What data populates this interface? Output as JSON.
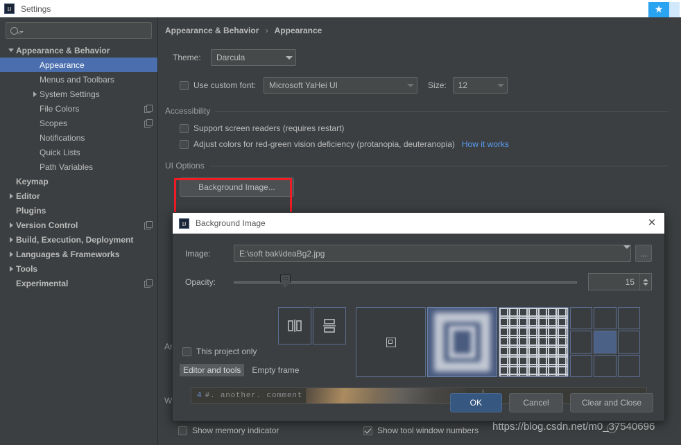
{
  "window": {
    "title": "Settings",
    "logo_icon": "intellij-idea-icon",
    "badge_icon": "baidu-netdisk-icon"
  },
  "sidebar": {
    "search": {
      "placeholder": "",
      "value": "",
      "icon": "search-icon"
    },
    "items": [
      {
        "label": "Appearance & Behavior",
        "indent": 0,
        "twisty": "down",
        "bold": true,
        "selected": false,
        "cfg": false
      },
      {
        "label": "Appearance",
        "indent": 1,
        "twisty": "none",
        "bold": false,
        "selected": true,
        "cfg": false
      },
      {
        "label": "Menus and Toolbars",
        "indent": 1,
        "twisty": "none",
        "bold": false,
        "selected": false,
        "cfg": false
      },
      {
        "label": "System Settings",
        "indent": 1,
        "twisty": "right",
        "bold": false,
        "selected": false,
        "cfg": false
      },
      {
        "label": "File Colors",
        "indent": 1,
        "twisty": "none",
        "bold": false,
        "selected": false,
        "cfg": true
      },
      {
        "label": "Scopes",
        "indent": 1,
        "twisty": "none",
        "bold": false,
        "selected": false,
        "cfg": true
      },
      {
        "label": "Notifications",
        "indent": 1,
        "twisty": "none",
        "bold": false,
        "selected": false,
        "cfg": false
      },
      {
        "label": "Quick Lists",
        "indent": 1,
        "twisty": "none",
        "bold": false,
        "selected": false,
        "cfg": false
      },
      {
        "label": "Path Variables",
        "indent": 1,
        "twisty": "none",
        "bold": false,
        "selected": false,
        "cfg": false
      },
      {
        "label": "Keymap",
        "indent": 0,
        "twisty": "none",
        "bold": true,
        "selected": false,
        "cfg": false
      },
      {
        "label": "Editor",
        "indent": 0,
        "twisty": "right",
        "bold": true,
        "selected": false,
        "cfg": false
      },
      {
        "label": "Plugins",
        "indent": 0,
        "twisty": "none",
        "bold": true,
        "selected": false,
        "cfg": false
      },
      {
        "label": "Version Control",
        "indent": 0,
        "twisty": "right",
        "bold": true,
        "selected": false,
        "cfg": true
      },
      {
        "label": "Build, Execution, Deployment",
        "indent": 0,
        "twisty": "right",
        "bold": true,
        "selected": false,
        "cfg": false
      },
      {
        "label": "Languages & Frameworks",
        "indent": 0,
        "twisty": "right",
        "bold": true,
        "selected": false,
        "cfg": false
      },
      {
        "label": "Tools",
        "indent": 0,
        "twisty": "right",
        "bold": true,
        "selected": false,
        "cfg": false
      },
      {
        "label": "Experimental",
        "indent": 0,
        "twisty": "none",
        "bold": true,
        "selected": false,
        "cfg": true
      }
    ]
  },
  "main": {
    "breadcrumb": {
      "root": "Appearance & Behavior",
      "separator": "›",
      "leaf": "Appearance"
    },
    "theme": {
      "label": "Theme:",
      "value": "Darcula"
    },
    "custom_font": {
      "checkbox_label": "Use custom font:",
      "checked": false,
      "font_value": "Microsoft YaHei UI",
      "size_label": "Size:",
      "size_value": "12"
    },
    "accessibility": {
      "group_label": "Accessibility",
      "screen_readers": {
        "label": "Support screen readers (requires restart)",
        "checked": false
      },
      "color_deficiency": {
        "label": "Adjust colors for red-green vision deficiency (protanopia, deuteranopia)",
        "checked": false,
        "link": "How it works"
      }
    },
    "ui_options": {
      "group_label": "UI Options",
      "background_image_button": "Background Image...",
      "highlight_color": "#ee1c25"
    },
    "obscured_labels": {
      "antialiasing": "An",
      "window": "W"
    },
    "bottom_options": [
      {
        "label": "Show memory indicator",
        "checked": false
      },
      {
        "label": "Show tool window numbers",
        "checked": true
      }
    ]
  },
  "dialog": {
    "title": "Background Image",
    "logo_icon": "intellij-idea-icon",
    "close_icon": "close-icon",
    "image": {
      "label": "Image:",
      "value": "E:\\soft bak\\ideaBg2.jpg",
      "browse_button": "..."
    },
    "opacity": {
      "label": "Opacity:",
      "value": "15",
      "percent": 15
    },
    "flip_buttons": [
      {
        "name": "flip-horizontal",
        "glyph": "horizontal-flip-icon"
      },
      {
        "name": "flip-vertical",
        "glyph": "vertical-flip-icon"
      }
    ],
    "fill_tiles": [
      {
        "name": "fill-center",
        "selected": false
      },
      {
        "name": "fill-scale",
        "selected": true
      },
      {
        "name": "fill-tile",
        "selected": false
      },
      {
        "name": "anchor-grid",
        "selected": false
      }
    ],
    "anchor_grid_selected_index": 4,
    "this_project_only": {
      "label": "This project only",
      "checked": false
    },
    "target_segments": [
      {
        "label": "Editor and tools",
        "selected": true
      },
      {
        "label": "Empty frame",
        "selected": false
      }
    ],
    "preview": {
      "line_number": "4",
      "code_text": "#. another. comment"
    },
    "buttons": {
      "ok": "OK",
      "cancel": "Cancel",
      "clear_and_close": "Clear and Close"
    }
  },
  "watermark": {
    "text": "https://blog.csdn.net/m0_37540696"
  }
}
